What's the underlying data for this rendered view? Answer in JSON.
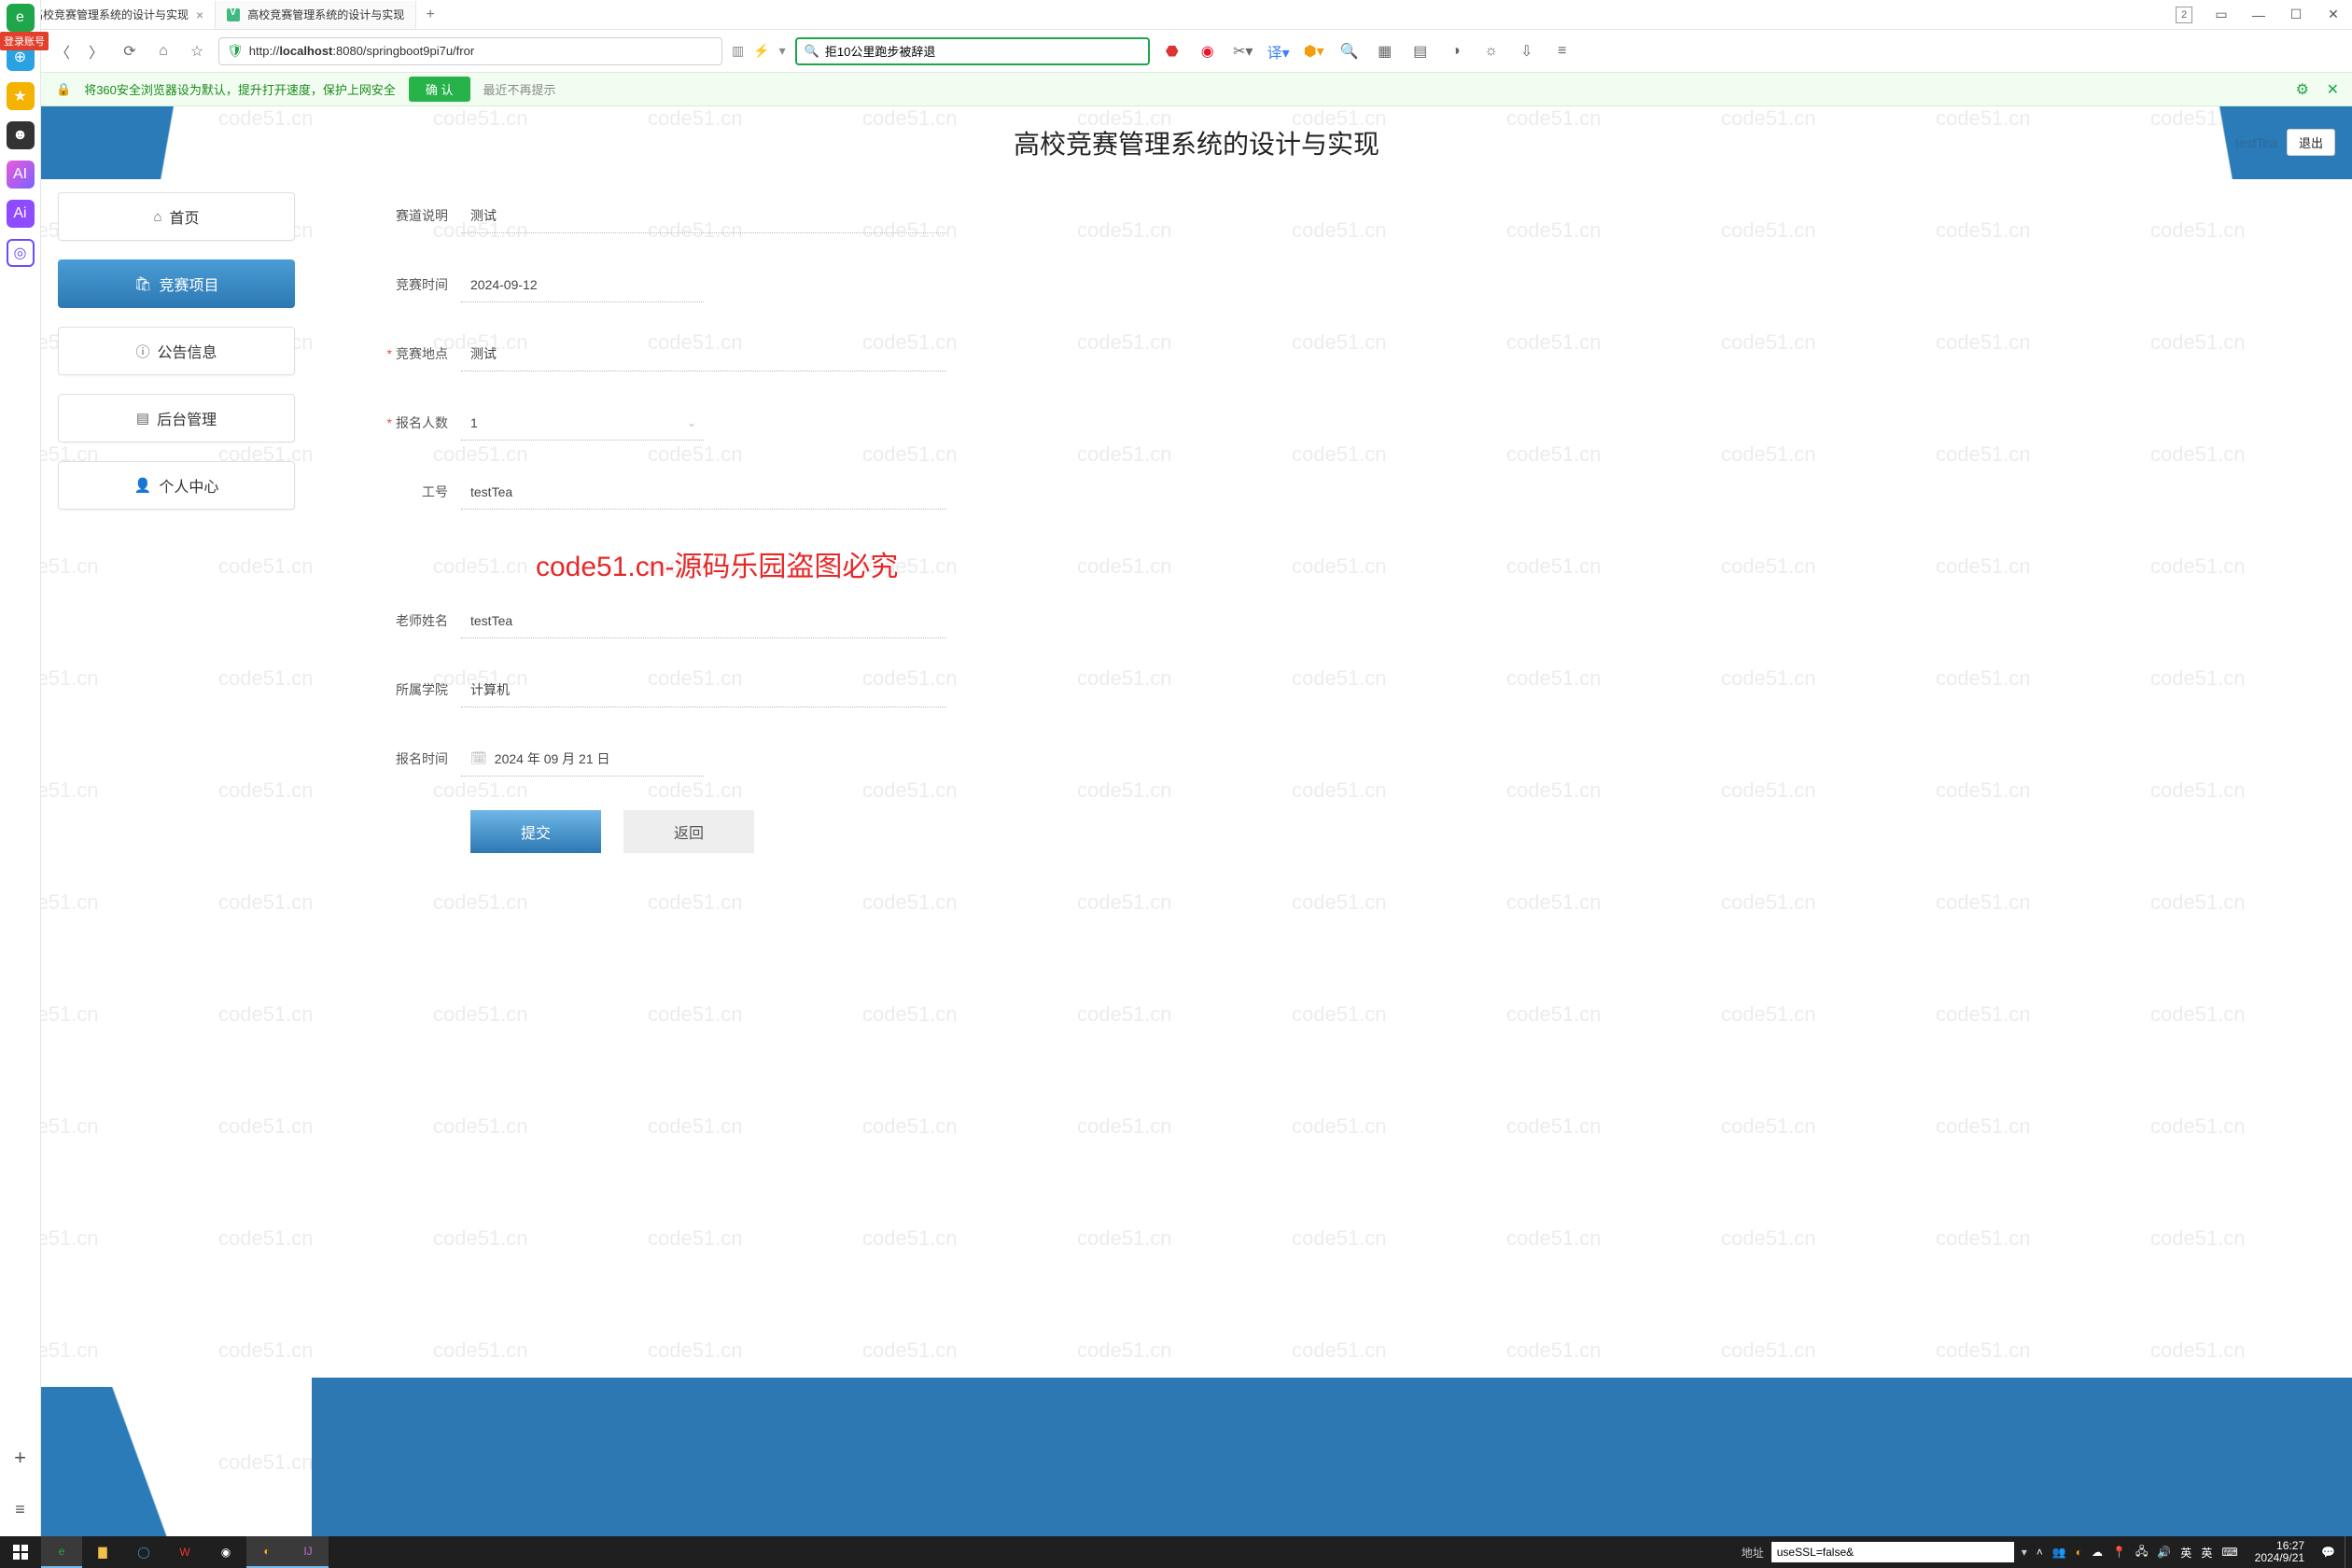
{
  "browser": {
    "tabs": [
      {
        "title": "高校竞赛管理系统的设计与实现",
        "active": true
      },
      {
        "title": "高校竞赛管理系统的设计与实现",
        "active": false
      }
    ],
    "tab_count_badge": "2",
    "url_display": "http://localhost:8080/springboot9pi7u/fror",
    "url_host": "localhost",
    "search_value": "拒10公里跑步被辞退",
    "login_tag": "登录账号",
    "banner": {
      "text": "将360安全浏览器设为默认，提升打开速度，保护上网安全",
      "ok": "确 认",
      "later": "最近不再提示"
    }
  },
  "app": {
    "title": "高校竞赛管理系统的设计与实现",
    "user": "testTea",
    "logout": "退出",
    "menu": {
      "home": "首页",
      "contest": "竞赛项目",
      "notice": "公告信息",
      "admin": "后台管理",
      "personal": "个人中心"
    },
    "form": {
      "label_track_desc": "赛道说明",
      "val_track_desc": "测试",
      "label_time": "竞赛时间",
      "val_time": "2024-09-12",
      "label_place": "竞赛地点",
      "val_place": "测试",
      "label_quota": "报名人数",
      "val_quota": "1",
      "label_jobno": "工号",
      "val_jobno": "testTea",
      "label_teacher": "老师姓名",
      "val_teacher": "testTea",
      "label_college": "所属学院",
      "val_college": "计算机",
      "label_apply_time": "报名时间",
      "val_apply_time": "2024 年 09 月 21 日",
      "submit": "提交",
      "back": "返回"
    },
    "watermark_text": "code51.cn",
    "big_watermark": "code51.cn-源码乐园盗图必究"
  },
  "taskbar": {
    "addr_label": "地址",
    "addr_value": "useSSL=false&",
    "ime": "英",
    "ime2": "英",
    "clock_time": "16:27",
    "clock_date": "2024/9/21"
  }
}
